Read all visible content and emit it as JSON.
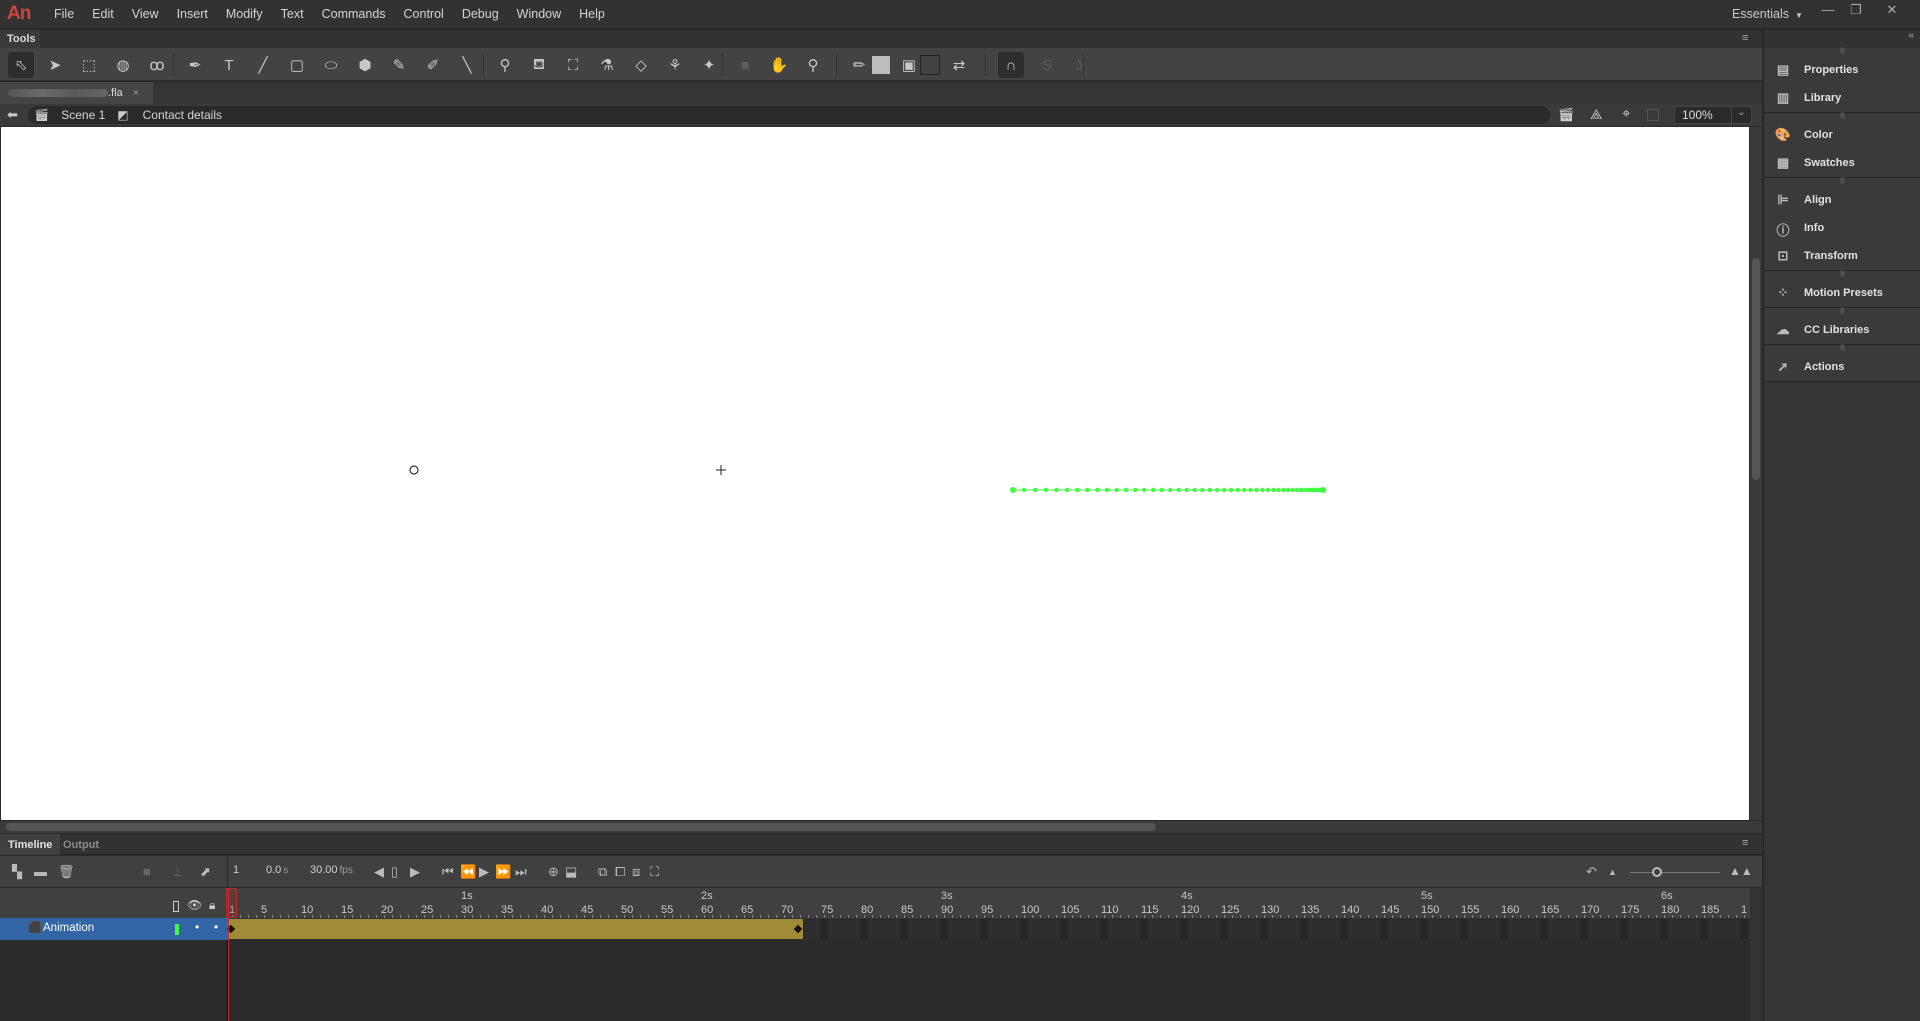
{
  "app": {
    "logo": "An",
    "workspace": "Essentials"
  },
  "menu": [
    "File",
    "Edit",
    "View",
    "Insert",
    "Modify",
    "Text",
    "Commands",
    "Control",
    "Debug",
    "Window",
    "Help"
  ],
  "window_controls": {
    "minimize": "—",
    "restore": "❐",
    "close": "✕"
  },
  "tools_panel": {
    "title": "Tools"
  },
  "tools": [
    {
      "name": "selection-tool",
      "glyph": "⬁",
      "selected": true
    },
    {
      "name": "subselection-tool",
      "glyph": "➤"
    },
    {
      "name": "free-transform-tool",
      "glyph": "⬚"
    },
    {
      "name": "3d-rotation-tool",
      "glyph": "◍"
    },
    {
      "name": "lasso-tool",
      "glyph": "ꝏ"
    },
    {
      "name": "pen-tool",
      "glyph": "✒"
    },
    {
      "name": "text-tool",
      "glyph": "T"
    },
    {
      "name": "line-tool",
      "glyph": "╱"
    },
    {
      "name": "rectangle-tool",
      "glyph": "▢"
    },
    {
      "name": "oval-tool",
      "glyph": "⬭"
    },
    {
      "name": "polystar-tool",
      "glyph": "⬢"
    },
    {
      "name": "pencil-tool",
      "glyph": "✎"
    },
    {
      "name": "paint-brush-tool",
      "glyph": "✐"
    },
    {
      "name": "brush-tool",
      "glyph": "╲"
    },
    {
      "name": "bone-tool",
      "glyph": "⚲"
    },
    {
      "name": "paint-bucket-tool",
      "glyph": "⛾"
    },
    {
      "name": "ink-bottle-tool",
      "glyph": "⛶"
    },
    {
      "name": "eyedropper-tool",
      "glyph": "⚗"
    },
    {
      "name": "eraser-tool",
      "glyph": "◇"
    },
    {
      "name": "width-tool",
      "glyph": "⚘"
    },
    {
      "name": "asset-warp-tool",
      "glyph": "✦"
    },
    {
      "name": "camera-tool",
      "glyph": "■"
    },
    {
      "name": "hand-tool",
      "glyph": "✋"
    },
    {
      "name": "zoom-tool",
      "glyph": "⚲"
    },
    {
      "name": "stroke-color-icon",
      "glyph": "✏"
    },
    {
      "name": "fill-color-swatch",
      "glyph": ""
    },
    {
      "name": "object-drawing-toggle",
      "glyph": "▣"
    },
    {
      "name": "no-color-swatch",
      "glyph": ""
    },
    {
      "name": "swap-colors-icon",
      "glyph": "⇄"
    },
    {
      "name": "snap-to-objects-toggle",
      "glyph": "∩"
    },
    {
      "name": "smooth-icon",
      "glyph": "S"
    },
    {
      "name": "straighten-icon",
      "glyph": "ʖ"
    }
  ],
  "document": {
    "filename_suffix": ".fla",
    "close": "×"
  },
  "breadcrumb": {
    "back": "⬅",
    "scene": "Scene 1",
    "symbol": "Contact details"
  },
  "zoom": {
    "value": "100%"
  },
  "stage": {
    "motion_path_color": "#3dff3d",
    "motion_path_points": 48
  },
  "right_panel": {
    "groups": [
      [
        {
          "label": "Properties",
          "icon": "properties-icon",
          "glyph": "▤"
        },
        {
          "label": "Library",
          "icon": "library-icon",
          "glyph": "▥"
        }
      ],
      [
        {
          "label": "Color",
          "icon": "color-palette-icon",
          "glyph": "🎨"
        },
        {
          "label": "Swatches",
          "icon": "swatches-icon",
          "glyph": "▦"
        }
      ],
      [
        {
          "label": "Align",
          "icon": "align-icon",
          "glyph": "⊫"
        },
        {
          "label": "Info",
          "icon": "info-icon",
          "glyph": "ⓘ"
        },
        {
          "label": "Transform",
          "icon": "transform-icon",
          "glyph": "⊡"
        }
      ],
      [
        {
          "label": "Motion Presets",
          "icon": "motion-presets-icon",
          "glyph": "⁘"
        }
      ],
      [
        {
          "label": "CC Libraries",
          "icon": "cc-libraries-icon",
          "glyph": "☁"
        }
      ],
      [
        {
          "label": "Actions",
          "icon": "actions-icon",
          "glyph": "➚"
        }
      ]
    ]
  },
  "timeline": {
    "tabs": [
      "Timeline",
      "Output"
    ],
    "active_tab": "Timeline",
    "current_frame": "1",
    "time": "0.0",
    "time_unit": "s",
    "fps": "30.00",
    "fps_unit": "fps",
    "seconds_labels": [
      "1s",
      "2s",
      "3s",
      "4s",
      "5s",
      "6s"
    ],
    "frame_labels": [
      "1",
      "5",
      "10",
      "15",
      "20",
      "25",
      "30",
      "35",
      "40",
      "45",
      "50",
      "55",
      "60",
      "65",
      "70",
      "75",
      "80",
      "85",
      "90",
      "95",
      "100",
      "105",
      "110",
      "115",
      "120",
      "125",
      "130",
      "135",
      "140",
      "145",
      "150",
      "155",
      "160",
      "165",
      "170",
      "175",
      "180",
      "185",
      "1"
    ],
    "tween_end_frame": 72,
    "layers": [
      {
        "name": "Animation",
        "outline_color": "#3dff3d",
        "selected": true
      }
    ],
    "zoom_slider_fraction": 0.3
  }
}
